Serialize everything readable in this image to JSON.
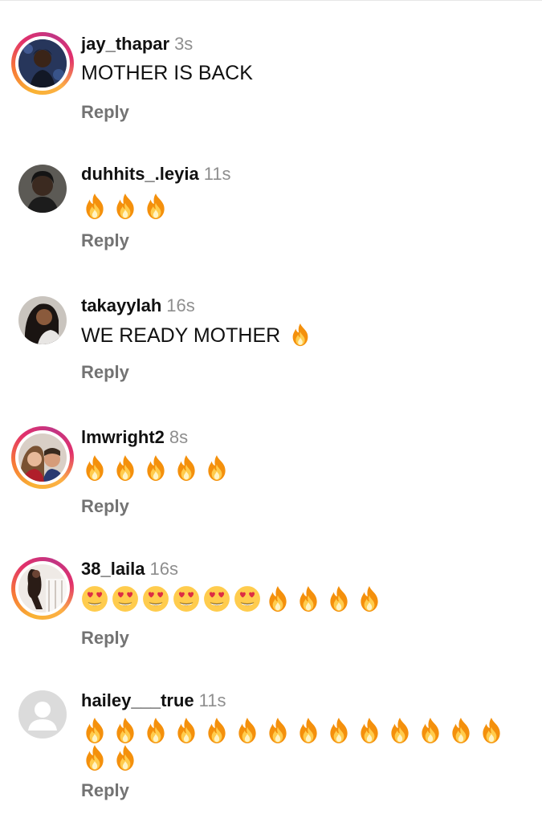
{
  "comments": [
    {
      "username": "jay_thapar",
      "time": "3s",
      "text": "MOTHER IS BACK",
      "emojis": [],
      "reply_label": "Reply",
      "avatar_ring": true
    },
    {
      "username": "duhhits_.leyia",
      "time": "11s",
      "text": "",
      "emojis": [
        "fire",
        "fire",
        "fire"
      ],
      "reply_label": "Reply",
      "avatar_ring": false
    },
    {
      "username": "takayylah",
      "time": "16s",
      "text": "WE READY MOTHER",
      "emojis": [
        "fire"
      ],
      "reply_label": "Reply",
      "avatar_ring": false
    },
    {
      "username": "lmwright2",
      "time": "8s",
      "text": "",
      "emojis": [
        "fire",
        "fire",
        "fire",
        "fire",
        "fire"
      ],
      "reply_label": "Reply",
      "avatar_ring": true
    },
    {
      "username": "38_laila",
      "time": "16s",
      "text": "",
      "emojis": [
        "heart-eyes",
        "heart-eyes",
        "heart-eyes",
        "heart-eyes",
        "heart-eyes",
        "heart-eyes",
        "fire",
        "fire",
        "fire",
        "fire"
      ],
      "reply_label": "Reply",
      "avatar_ring": true
    },
    {
      "username": "hailey___true",
      "time": "11s",
      "text": "",
      "emojis": [
        "fire",
        "fire",
        "fire",
        "fire",
        "fire",
        "fire",
        "fire",
        "fire",
        "fire",
        "fire",
        "fire",
        "fire",
        "fire",
        "fire",
        "fire",
        "fire"
      ],
      "reply_label": "Reply",
      "avatar_ring": false
    }
  ],
  "colors": {
    "username": "#111111",
    "timestamp": "#8e8e8e",
    "reply": "#737373",
    "story_ring_start": "#f9b233",
    "story_ring_end": "#c13584"
  }
}
